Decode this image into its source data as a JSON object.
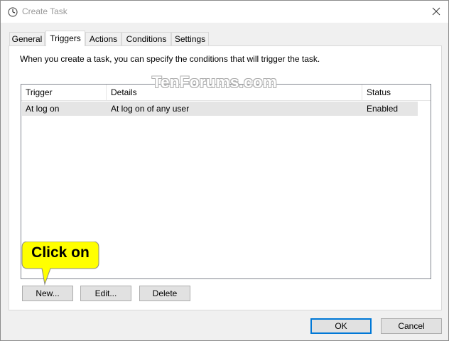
{
  "window": {
    "title": "Create Task"
  },
  "tabs": [
    {
      "label": "General",
      "active": false
    },
    {
      "label": "Triggers",
      "active": true
    },
    {
      "label": "Actions",
      "active": false
    },
    {
      "label": "Conditions",
      "active": false
    },
    {
      "label": "Settings",
      "active": false
    }
  ],
  "triggers": {
    "intro": "When you create a task, you can specify the conditions that will trigger the task.",
    "columns": [
      "Trigger",
      "Details",
      "Status"
    ],
    "rows": [
      {
        "trigger": "At log on",
        "details": "At log on of any user",
        "status": "Enabled"
      }
    ],
    "buttons": {
      "new": "New...",
      "edit": "Edit...",
      "delete": "Delete"
    }
  },
  "footer": {
    "ok": "OK",
    "cancel": "Cancel"
  },
  "annotation": {
    "callout": "Click on",
    "color": "#ffff00"
  },
  "watermark": "TenForums.com",
  "colors": {
    "accent": "#0078d7",
    "selected_row": "#e5e5e5"
  }
}
